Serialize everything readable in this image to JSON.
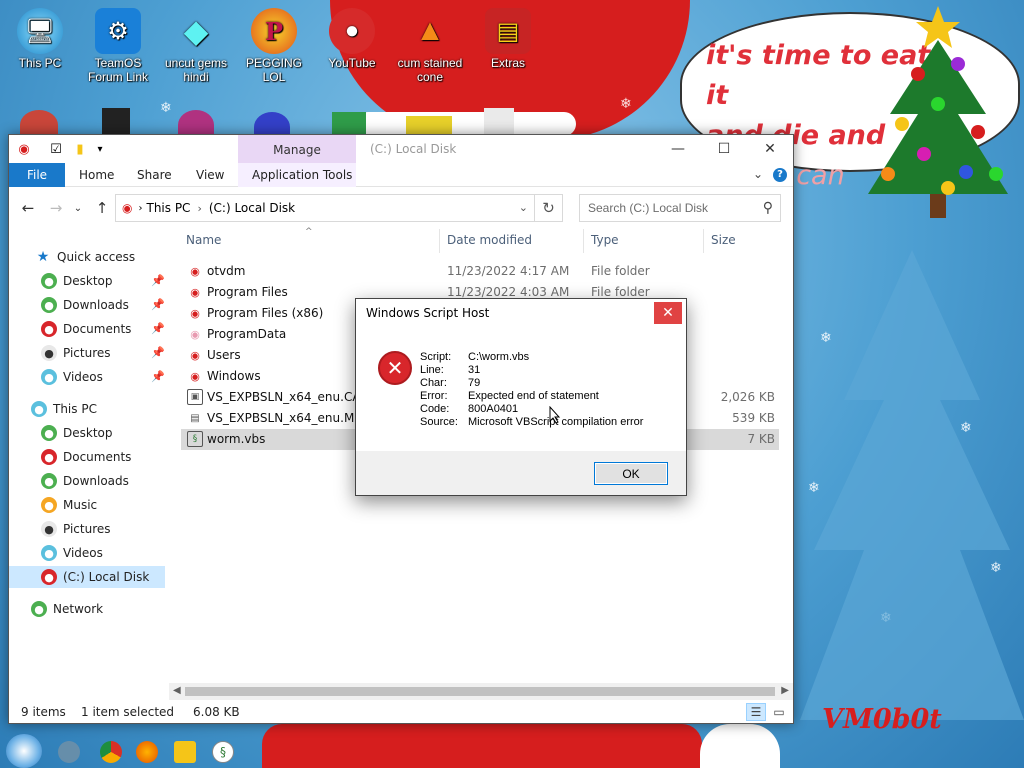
{
  "desktop": {
    "icons": [
      {
        "label": "This PC",
        "icon": "monitor-icon",
        "glyph": "🖥"
      },
      {
        "label": "TeamOS Forum Link",
        "icon": "gear-icon",
        "glyph": "⚙"
      },
      {
        "label": "uncut gems hindi",
        "icon": "diamond-icon",
        "glyph": "💎"
      },
      {
        "label": "PEGGING LOL",
        "icon": "p-logo-icon",
        "glyph": "P"
      },
      {
        "label": "YouTube",
        "icon": "angry-bird-icon",
        "glyph": "🐦"
      },
      {
        "label": "cum stained cone",
        "icon": "traffic-cone-icon",
        "glyph": "🍦"
      },
      {
        "label": "Extras",
        "icon": "archive-icon",
        "glyph": "📦"
      }
    ],
    "speech_bubble": {
      "line1": "it's time to eat it",
      "line2": "and die and",
      "line3": "candy can"
    },
    "signature": "VM0b0t"
  },
  "explorer": {
    "ribbon_context": "Manage",
    "title": "(C:) Local Disk",
    "ribbon_tabs": [
      "File",
      "Home",
      "Share",
      "View",
      "Application Tools"
    ],
    "address": {
      "root": "This PC",
      "current": "(C:) Local Disk"
    },
    "search": {
      "placeholder": "Search (C:) Local Disk"
    },
    "nav": {
      "quick_access": "Quick access",
      "quick_items": [
        "Desktop",
        "Downloads",
        "Documents",
        "Pictures",
        "Videos"
      ],
      "this_pc": "This PC",
      "pc_items": [
        "Desktop",
        "Documents",
        "Downloads",
        "Music",
        "Pictures",
        "Videos",
        "(C:) Local Disk"
      ],
      "network": "Network"
    },
    "columns": {
      "name": "Name",
      "date": "Date modified",
      "type": "Type",
      "size": "Size"
    },
    "files": [
      {
        "name": "otvdm",
        "date": "11/23/2022 4:17 AM",
        "type": "File folder",
        "size": ""
      },
      {
        "name": "Program Files",
        "date": "11/23/2022 4:03 AM",
        "type": "File folder",
        "size": ""
      },
      {
        "name": "Program Files (x86)",
        "date": "",
        "type": "",
        "size": ""
      },
      {
        "name": "ProgramData",
        "date": "",
        "type": "",
        "size": ""
      },
      {
        "name": "Users",
        "date": "",
        "type": "",
        "size": ""
      },
      {
        "name": "Windows",
        "date": "",
        "type": "",
        "size": ""
      },
      {
        "name": "VS_EXPBSLN_x64_enu.CAB",
        "date": "",
        "type": "",
        "size": "2,026 KB"
      },
      {
        "name": "VS_EXPBSLN_x64_enu.MSI",
        "date": "",
        "type": "",
        "size": "539 KB"
      },
      {
        "name": "worm.vbs",
        "date": "",
        "type": "",
        "size": "7 KB"
      }
    ],
    "status": {
      "items": "9 items",
      "selected": "1 item selected",
      "size": "6.08 KB"
    }
  },
  "dialog": {
    "title": "Windows Script Host",
    "lines": [
      {
        "key": "Script:",
        "value": "C:\\worm.vbs"
      },
      {
        "key": "Line:",
        "value": "31"
      },
      {
        "key": "Char:",
        "value": "79"
      },
      {
        "key": "Error:",
        "value": "Expected end of statement"
      },
      {
        "key": "Code:",
        "value": "800A0401"
      },
      {
        "key": "Source:",
        "value": "Microsoft VBScript compilation error"
      }
    ],
    "ok_label": "OK"
  },
  "colors": {
    "accent": "#1979ca",
    "dialog_close": "#e04343",
    "selection": "#cce8ff",
    "error": "#d8262b"
  }
}
